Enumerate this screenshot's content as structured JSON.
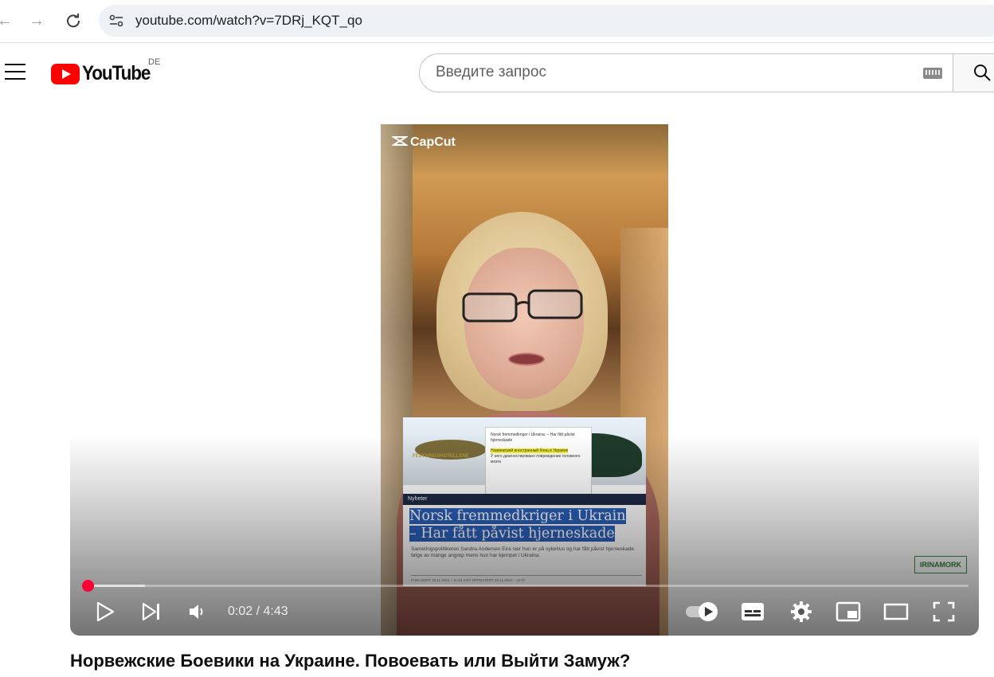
{
  "browser": {
    "url": "youtube.com/watch?v=7DRj_KQT_qo",
    "icons": [
      "back-arrow-icon",
      "forward-arrow-icon",
      "reload-icon",
      "site-info-icon"
    ]
  },
  "header": {
    "logo_text": "YouTube",
    "country_code": "DE",
    "search_placeholder": "Введите запрос",
    "icons": [
      "menu-icon",
      "youtube-logo-icon",
      "keyboard-icon",
      "search-icon"
    ]
  },
  "video": {
    "overlay_brand": "CapCut",
    "watermark": "IRINAMORK",
    "article": {
      "section": "Nyheter",
      "headline_line1": "Norsk fremmedkriger i Ukrain",
      "headline_line2": "– Har fått påvist hjerneskade",
      "subtext": "Sametingspolitikeren Sandra Andersen Eira sier hun er på sykehus og har fått påvist hjerneskade følge av mange angrep mens hun har kjempet i Ukraina.",
      "meta": "PUBLISERT 28.11.2024 – 11:18   SIST OPPDATERT 28.11.2024 – 12:07",
      "image_label": "FESTNINGSHOTELLENE",
      "popup_line1": "Norsk fremmedkriger i Ukraina: – Har fått påvist hjerneskade",
      "popup_line2": "Норвежский иностранный боец в Украине",
      "popup_line3": "У него диагностировано повреждение головного мозга"
    },
    "player": {
      "current_time": "0:02",
      "duration": "4:43",
      "time_display": "0:02 / 4:43",
      "played_fraction": 0.007,
      "buffered_fraction": 0.065,
      "accent_color": "#ff0033",
      "icons": [
        "play-icon",
        "next-icon",
        "volume-icon",
        "autoplay-toggle-icon",
        "subtitles-icon",
        "settings-gear-icon",
        "miniplayer-icon",
        "theater-mode-icon",
        "fullscreen-icon"
      ]
    }
  },
  "title": "Норвежские Боевики на Украине. Повоевать или Выйти Замуж?"
}
